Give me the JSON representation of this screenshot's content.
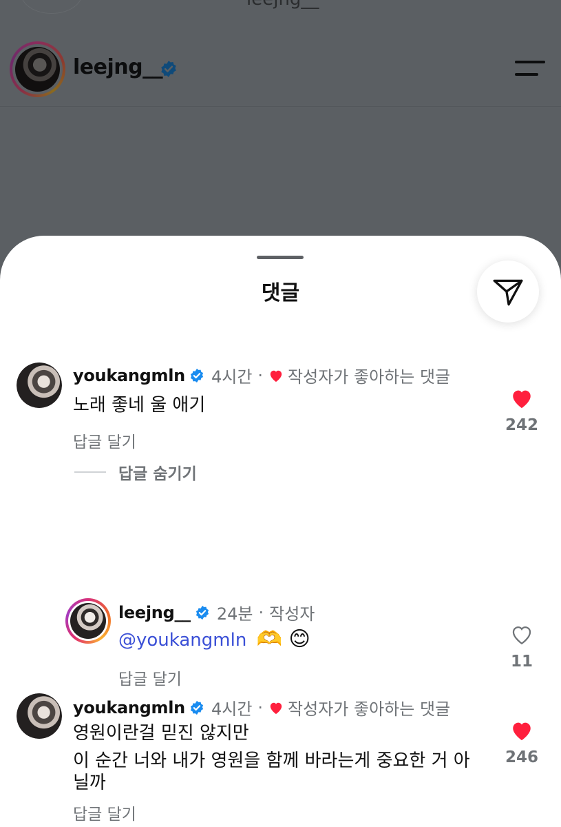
{
  "background": {
    "top_partial_name": "leejng__",
    "profile_username": "leejng__",
    "menu_icon": "hamburger-menu-icon"
  },
  "sheet": {
    "title": "댓글",
    "share_icon": "send-paper-plane-icon"
  },
  "comments": [
    {
      "username": "youkangmln",
      "verified": true,
      "time": "4시간",
      "creator_liked_label": "작성자가 좋아하는 댓글",
      "text_lines": [
        "노래 좋네 울 애기"
      ],
      "reply_label": "답글 달기",
      "liked": true,
      "like_count": "242"
    },
    {
      "username": "leejng__",
      "verified": true,
      "time": "24분",
      "author_label": "작성자",
      "mention": "@youkangmln",
      "emojis": "🫶 😊",
      "reply_label": "답글 달기",
      "liked": false,
      "like_count": "11"
    },
    {
      "username": "youkangmln",
      "verified": true,
      "time": "4시간",
      "creator_liked_label": "작성자가 좋아하는 댓글",
      "text_lines": [
        "영원이란걸 믿진 않지만",
        "이 순간 너와 내가 영원을 함께 바라는게 중요한 거 아",
        "닐까"
      ],
      "reply_label": "답글 달기",
      "liked": true,
      "like_count": "246"
    }
  ],
  "hide_replies_label": "답글 숨기기",
  "colors": {
    "verified_blue": "#1a8cf0",
    "like_red": "#ff1f3d",
    "mention_blue": "#3a4fd6",
    "muted_text": "#6f7377"
  }
}
